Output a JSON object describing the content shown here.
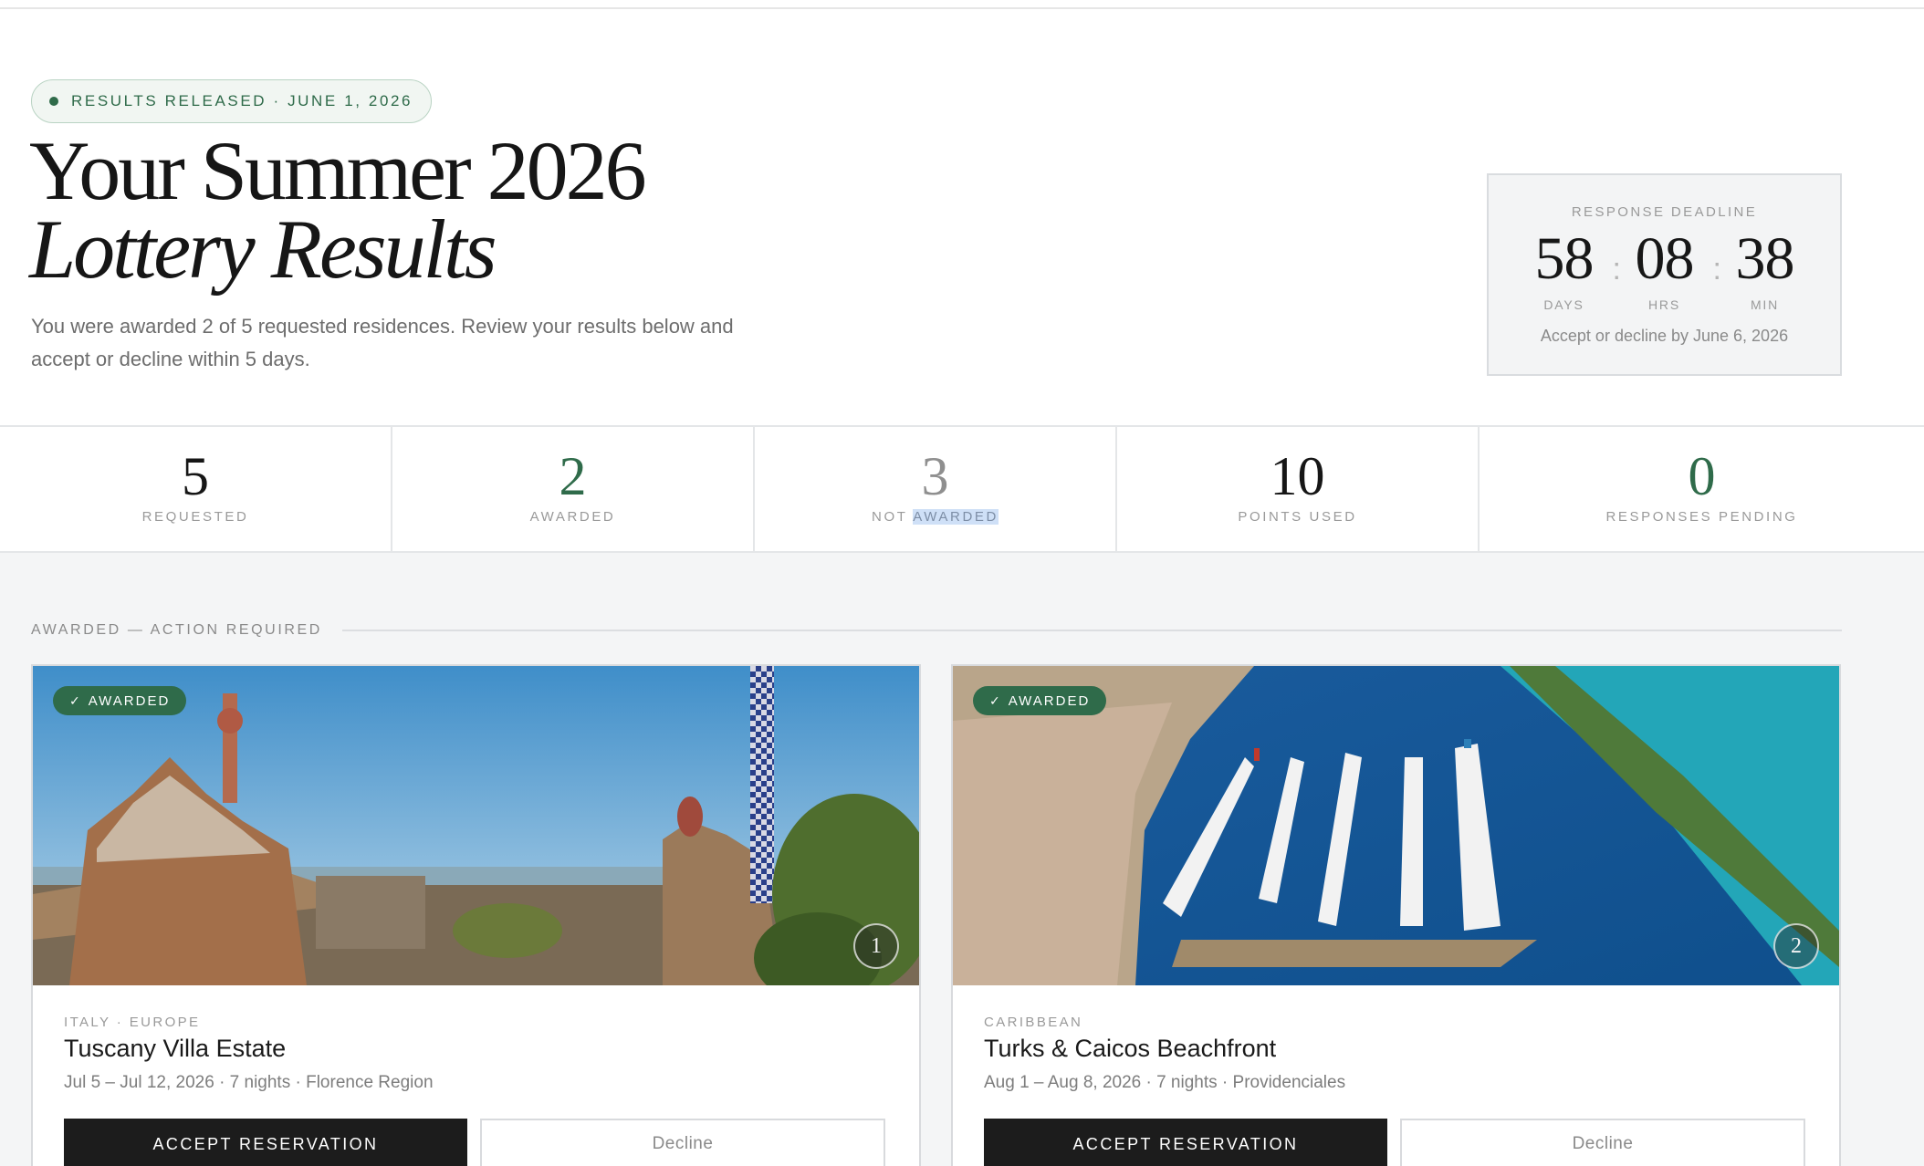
{
  "status_pill": {
    "text": "RESULTS RELEASED · JUNE 1, 2026"
  },
  "title": {
    "line1": "Your Summer 2026",
    "line2": "Lottery Results"
  },
  "intro": "You were awarded 2 of 5 requested residences. Review your results below and accept or decline within 5 days.",
  "deadline": {
    "label": "RESPONSE DEADLINE",
    "days": "58",
    "days_label": "DAYS",
    "hrs": "08",
    "hrs_label": "HRS",
    "min": "38",
    "min_label": "MIN",
    "separator": ":",
    "note": "Accept or decline by June 6, 2026"
  },
  "stats": [
    {
      "value": "5",
      "label": "REQUESTED"
    },
    {
      "value": "2",
      "label": "AWARDED"
    },
    {
      "value": "3",
      "label_prefix": "NOT ",
      "label_highlight": "AWARDED"
    },
    {
      "value": "10",
      "label": "POINTS USED"
    },
    {
      "value": "0",
      "label": "RESPONSES PENDING"
    }
  ],
  "section": {
    "label": "AWARDED — ACTION REQUIRED"
  },
  "cards": [
    {
      "badge": "AWARDED",
      "badge_icon": "check-icon",
      "rank": "1",
      "region": "ITALY · EUROPE",
      "name": "Tuscany Villa Estate",
      "meta": "Jul 5 – Jul 12, 2026 · 7 nights · Florence Region",
      "accept_label": "ACCEPT RESERVATION",
      "decline_label": "Decline"
    },
    {
      "badge": "AWARDED",
      "badge_icon": "check-icon",
      "rank": "2",
      "region": "CARIBBEAN",
      "name": "Turks & Caicos Beachfront",
      "meta": "Aug 1 – Aug 8, 2026 · 7 nights · Providenciales",
      "accept_label": "ACCEPT RESERVATION",
      "decline_label": "Decline"
    }
  ],
  "colors": {
    "accent_green": "#2f6b4a",
    "dark_button": "#1c1c1c",
    "page_bg": "#f4f5f6"
  }
}
